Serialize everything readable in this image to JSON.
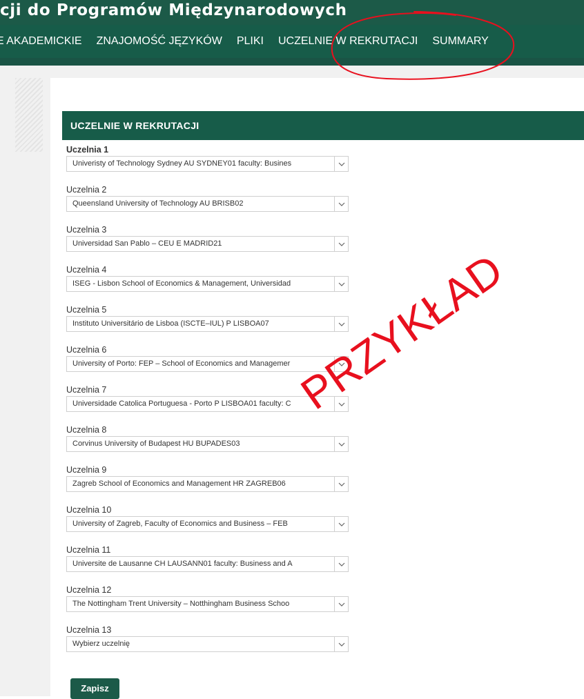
{
  "header": {
    "site_title": "cji do Programów Międzynarodowych",
    "nav": [
      {
        "label": "E AKADEMICKIE"
      },
      {
        "label": "ZNAJOMOŚĆ JĘZYKÓW"
      },
      {
        "label": "PLIKI"
      },
      {
        "label": "UCZELNIE W REKRUTACJI",
        "active": true
      },
      {
        "label": "SUMMARY"
      }
    ],
    "color": "#1c5a48"
  },
  "panel": {
    "title": "UCZELNIE W REKRUTACJI"
  },
  "fields": [
    {
      "label": "Uczelnia 1",
      "value": "Univeristy of Technology Sydney AU SYDNEY01 faculty: Busines"
    },
    {
      "label": "Uczelnia 2",
      "value": "Queensland University of Technology AU BRISB02"
    },
    {
      "label": "Uczelnia 3",
      "value": "Universidad San Pablo – CEU E MADRID21"
    },
    {
      "label": "Uczelnia 4",
      "value": "ISEG - Lisbon School of Economics & Management, Universidad"
    },
    {
      "label": "Uczelnia 5",
      "value": "Instituto Universitário de Lisboa (ISCTE–IUL) P LISBOA07"
    },
    {
      "label": "Uczelnia 6",
      "value": "University of Porto: FEP – School of Economics and Managemer"
    },
    {
      "label": "Uczelnia 7",
      "value": "Universidade Catolica Portuguesa - Porto P LISBOA01 faculty: C"
    },
    {
      "label": "Uczelnia 8",
      "value": "Corvinus University of Budapest HU BUPADES03"
    },
    {
      "label": "Uczelnia 9",
      "value": "Zagreb School of Economics and Management HR ZAGREB06"
    },
    {
      "label": "Uczelnia 10",
      "value": "University of Zagreb, Faculty of Economics and Business – FEB"
    },
    {
      "label": "Uczelnia 11",
      "value": "Universite de Lausanne CH LAUSANN01 faculty: Business and A"
    },
    {
      "label": "Uczelnia 12",
      "value": "The Nottingham Trent University – Notthingham Business Schoo"
    },
    {
      "label": "Uczelnia 13",
      "value": "Wybierz uczelnię"
    }
  ],
  "save_label": "Zapisz",
  "watermark": "PRZYKŁAD",
  "annotation_color": "#e8101e",
  "icons": {
    "dropdown": "chevron-down-icon"
  }
}
